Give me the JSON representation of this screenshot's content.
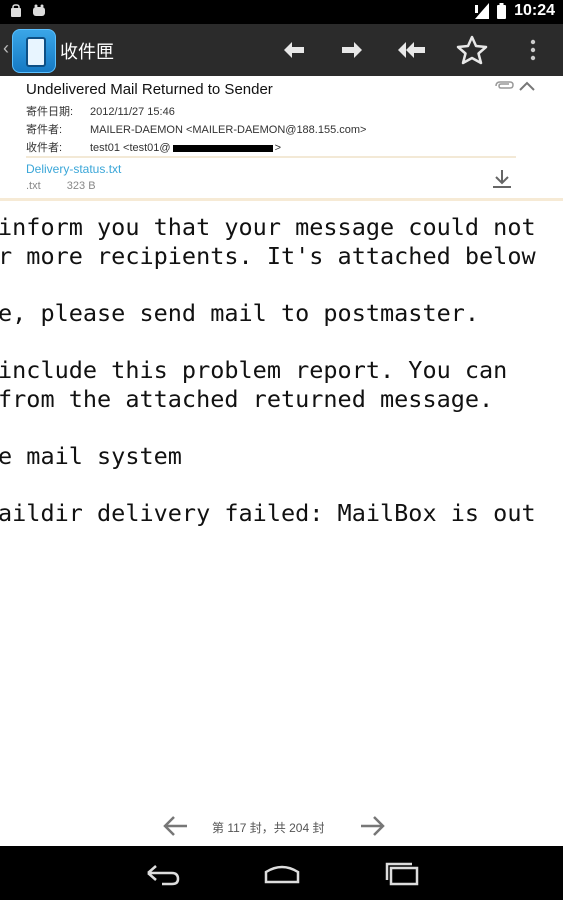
{
  "status_bar": {
    "time": "10:24",
    "icons": [
      "shield-icon",
      "notification-icon",
      "signal-icon",
      "battery-icon"
    ]
  },
  "action_bar": {
    "title": "收件匣",
    "buttons": [
      "reply-icon",
      "forward-icon",
      "reply-all-icon",
      "star-icon",
      "more-icon"
    ]
  },
  "email": {
    "subject": "Undelivered Mail Returned to Sender",
    "date_label": "寄件日期:",
    "date": "2012/11/27 15:46",
    "from_label": "寄件者:",
    "from": "MAILER-DAEMON <MAILER-DAEMON@188.155.com>",
    "to_label": "收件者:",
    "to_prefix": "test01 <test01@",
    "to_suffix": ">",
    "attachment": {
      "name": "Delivery-status.txt",
      "type": ".txt",
      "size": "323 B"
    }
  },
  "body_lines": [
    "inform you that your message could not",
    "r more recipients. It's attached below",
    "",
    "e, please send mail to postmaster.",
    "",
    "include this problem report. You can",
    "from the attached returned message.",
    "",
    "e mail system",
    "",
    "aildir delivery failed: MailBox is out"
  ],
  "pager": {
    "text": "第 117 封，共 204 封"
  },
  "colors": {
    "action_bar": "#2b2b2b",
    "link": "#3aa6d8",
    "accent": "#1579c4"
  }
}
